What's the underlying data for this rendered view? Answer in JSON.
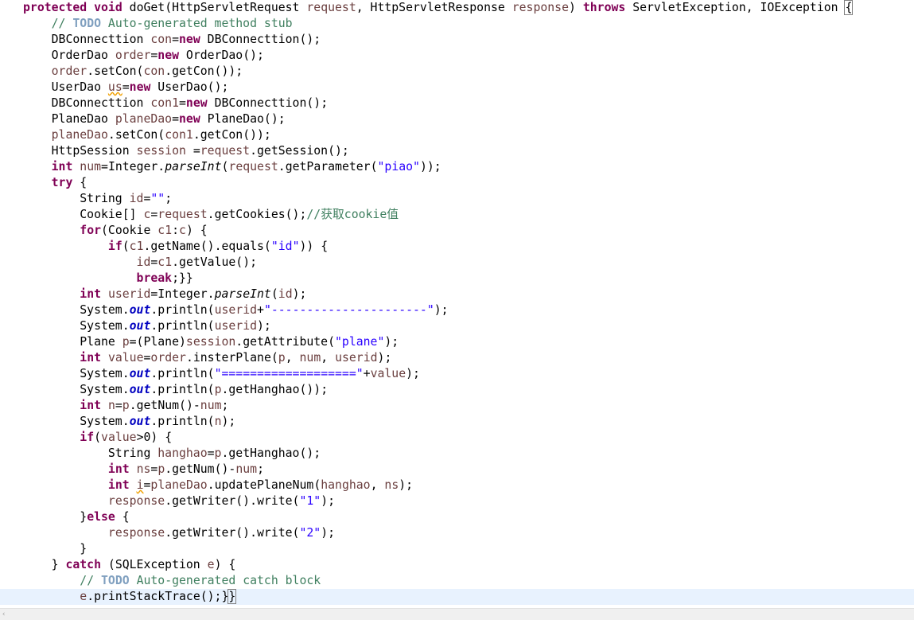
{
  "code": {
    "current_line_index": 37,
    "lines": [
      [
        [
          "kw",
          "protected"
        ],
        [
          "p",
          " "
        ],
        [
          "kw",
          "void"
        ],
        [
          "p",
          " doGet(HttpServletRequest "
        ],
        [
          "var",
          "request"
        ],
        [
          "p",
          ", HttpServletResponse "
        ],
        [
          "var",
          "response"
        ],
        [
          "p",
          ") "
        ],
        [
          "kw",
          "throws"
        ],
        [
          "p",
          " ServletException, IOException "
        ],
        [
          "bracket",
          "{"
        ]
      ],
      [
        [
          "p",
          "    "
        ],
        [
          "cm",
          "// "
        ],
        [
          "todo",
          "TODO"
        ],
        [
          "cm",
          " Auto-generated method stub"
        ]
      ],
      [
        [
          "p",
          "    DBConnecttion "
        ],
        [
          "var",
          "con"
        ],
        [
          "p",
          "="
        ],
        [
          "kw",
          "new"
        ],
        [
          "p",
          " DBConnecttion();"
        ]
      ],
      [
        [
          "p",
          "    OrderDao "
        ],
        [
          "var",
          "order"
        ],
        [
          "p",
          "="
        ],
        [
          "kw",
          "new"
        ],
        [
          "p",
          " OrderDao();"
        ]
      ],
      [
        [
          "p",
          "    "
        ],
        [
          "var",
          "order"
        ],
        [
          "p",
          ".setCon("
        ],
        [
          "var",
          "con"
        ],
        [
          "p",
          ".getCon());"
        ]
      ],
      [
        [
          "p",
          "    UserDao "
        ],
        [
          "warn",
          "us"
        ],
        [
          "p",
          "="
        ],
        [
          "kw",
          "new"
        ],
        [
          "p",
          " UserDao();"
        ]
      ],
      [
        [
          "p",
          "    DBConnecttion "
        ],
        [
          "var",
          "con1"
        ],
        [
          "p",
          "="
        ],
        [
          "kw",
          "new"
        ],
        [
          "p",
          " DBConnecttion();"
        ]
      ],
      [
        [
          "p",
          "    PlaneDao "
        ],
        [
          "var",
          "planeDao"
        ],
        [
          "p",
          "="
        ],
        [
          "kw",
          "new"
        ],
        [
          "p",
          " PlaneDao();"
        ]
      ],
      [
        [
          "p",
          "    "
        ],
        [
          "var",
          "planeDao"
        ],
        [
          "p",
          ".setCon("
        ],
        [
          "var",
          "con1"
        ],
        [
          "p",
          ".getCon());"
        ]
      ],
      [
        [
          "p",
          "    HttpSession "
        ],
        [
          "var",
          "session"
        ],
        [
          "p",
          " ="
        ],
        [
          "var",
          "request"
        ],
        [
          "p",
          ".getSession();"
        ]
      ],
      [
        [
          "p",
          "    "
        ],
        [
          "kw",
          "int"
        ],
        [
          "p",
          " "
        ],
        [
          "var",
          "num"
        ],
        [
          "p",
          "=Integer."
        ],
        [
          "it",
          "parseInt"
        ],
        [
          "p",
          "("
        ],
        [
          "var",
          "request"
        ],
        [
          "p",
          ".getParameter("
        ],
        [
          "str",
          "\"piao\""
        ],
        [
          "p",
          "));"
        ]
      ],
      [
        [
          "p",
          "    "
        ],
        [
          "kw",
          "try"
        ],
        [
          "p",
          " {"
        ]
      ],
      [
        [
          "p",
          "        String "
        ],
        [
          "var",
          "id"
        ],
        [
          "p",
          "="
        ],
        [
          "str",
          "\"\""
        ],
        [
          "p",
          ";"
        ]
      ],
      [
        [
          "p",
          "        Cookie[] "
        ],
        [
          "var",
          "c"
        ],
        [
          "p",
          "="
        ],
        [
          "var",
          "request"
        ],
        [
          "p",
          ".getCookies();"
        ],
        [
          "cm",
          "//获取cookie值"
        ]
      ],
      [
        [
          "p",
          "        "
        ],
        [
          "kw",
          "for"
        ],
        [
          "p",
          "(Cookie "
        ],
        [
          "var",
          "c1"
        ],
        [
          "p",
          ":"
        ],
        [
          "var",
          "c"
        ],
        [
          "p",
          ") {"
        ]
      ],
      [
        [
          "p",
          "            "
        ],
        [
          "kw",
          "if"
        ],
        [
          "p",
          "("
        ],
        [
          "var",
          "c1"
        ],
        [
          "p",
          ".getName().equals("
        ],
        [
          "str",
          "\"id\""
        ],
        [
          "p",
          ")) {"
        ]
      ],
      [
        [
          "p",
          "                "
        ],
        [
          "var",
          "id"
        ],
        [
          "p",
          "="
        ],
        [
          "var",
          "c1"
        ],
        [
          "p",
          ".getValue();"
        ]
      ],
      [
        [
          "p",
          "                "
        ],
        [
          "kw",
          "break"
        ],
        [
          "p",
          ";}}"
        ]
      ],
      [
        [
          "p",
          "        "
        ],
        [
          "kw",
          "int"
        ],
        [
          "p",
          " "
        ],
        [
          "var",
          "userid"
        ],
        [
          "p",
          "=Integer."
        ],
        [
          "it",
          "parseInt"
        ],
        [
          "p",
          "("
        ],
        [
          "var",
          "id"
        ],
        [
          "p",
          ");"
        ]
      ],
      [
        [
          "p",
          "        System."
        ],
        [
          "st",
          "out"
        ],
        [
          "p",
          ".println("
        ],
        [
          "var",
          "userid"
        ],
        [
          "p",
          "+"
        ],
        [
          "str",
          "\"----------------------\""
        ],
        [
          "p",
          ");"
        ]
      ],
      [
        [
          "p",
          "        System."
        ],
        [
          "st",
          "out"
        ],
        [
          "p",
          ".println("
        ],
        [
          "var",
          "userid"
        ],
        [
          "p",
          ");"
        ]
      ],
      [
        [
          "p",
          "        Plane "
        ],
        [
          "var",
          "p"
        ],
        [
          "p",
          "=(Plane)"
        ],
        [
          "var",
          "session"
        ],
        [
          "p",
          ".getAttribute("
        ],
        [
          "str",
          "\"plane\""
        ],
        [
          "p",
          ");"
        ]
      ],
      [
        [
          "p",
          "        "
        ],
        [
          "kw",
          "int"
        ],
        [
          "p",
          " "
        ],
        [
          "var",
          "value"
        ],
        [
          "p",
          "="
        ],
        [
          "var",
          "order"
        ],
        [
          "p",
          ".insterPlane("
        ],
        [
          "var",
          "p"
        ],
        [
          "p",
          ", "
        ],
        [
          "var",
          "num"
        ],
        [
          "p",
          ", "
        ],
        [
          "var",
          "userid"
        ],
        [
          "p",
          ");"
        ]
      ],
      [
        [
          "p",
          "        System."
        ],
        [
          "st",
          "out"
        ],
        [
          "p",
          ".println("
        ],
        [
          "str",
          "\"===================\""
        ],
        [
          "p",
          "+"
        ],
        [
          "var",
          "value"
        ],
        [
          "p",
          ");"
        ]
      ],
      [
        [
          "p",
          "        System."
        ],
        [
          "st",
          "out"
        ],
        [
          "p",
          ".println("
        ],
        [
          "var",
          "p"
        ],
        [
          "p",
          ".getHanghao());"
        ]
      ],
      [
        [
          "p",
          "        "
        ],
        [
          "kw",
          "int"
        ],
        [
          "p",
          " "
        ],
        [
          "var",
          "n"
        ],
        [
          "p",
          "="
        ],
        [
          "var",
          "p"
        ],
        [
          "p",
          ".getNum()-"
        ],
        [
          "var",
          "num"
        ],
        [
          "p",
          ";"
        ]
      ],
      [
        [
          "p",
          "        System."
        ],
        [
          "st",
          "out"
        ],
        [
          "p",
          ".println("
        ],
        [
          "var",
          "n"
        ],
        [
          "p",
          ");"
        ]
      ],
      [
        [
          "p",
          "        "
        ],
        [
          "kw",
          "if"
        ],
        [
          "p",
          "("
        ],
        [
          "var",
          "value"
        ],
        [
          "p",
          ">0) {"
        ]
      ],
      [
        [
          "p",
          "            String "
        ],
        [
          "var",
          "hanghao"
        ],
        [
          "p",
          "="
        ],
        [
          "var",
          "p"
        ],
        [
          "p",
          ".getHanghao();"
        ]
      ],
      [
        [
          "p",
          "            "
        ],
        [
          "kw",
          "int"
        ],
        [
          "p",
          " "
        ],
        [
          "var",
          "ns"
        ],
        [
          "p",
          "="
        ],
        [
          "var",
          "p"
        ],
        [
          "p",
          ".getNum()-"
        ],
        [
          "var",
          "num"
        ],
        [
          "p",
          ";"
        ]
      ],
      [
        [
          "p",
          "            "
        ],
        [
          "kw",
          "int"
        ],
        [
          "p",
          " "
        ],
        [
          "warn",
          "i"
        ],
        [
          "p",
          "="
        ],
        [
          "var",
          "planeDao"
        ],
        [
          "p",
          ".updatePlaneNum("
        ],
        [
          "var",
          "hanghao"
        ],
        [
          "p",
          ", "
        ],
        [
          "var",
          "ns"
        ],
        [
          "p",
          ");"
        ]
      ],
      [
        [
          "p",
          "            "
        ],
        [
          "var",
          "response"
        ],
        [
          "p",
          ".getWriter().write("
        ],
        [
          "str",
          "\"1\""
        ],
        [
          "p",
          ");"
        ]
      ],
      [
        [
          "p",
          "        }"
        ],
        [
          "kw",
          "else"
        ],
        [
          "p",
          " {"
        ]
      ],
      [
        [
          "p",
          "            "
        ],
        [
          "var",
          "response"
        ],
        [
          "p",
          ".getWriter().write("
        ],
        [
          "str",
          "\"2\""
        ],
        [
          "p",
          ");"
        ]
      ],
      [
        [
          "p",
          "        }"
        ]
      ],
      [
        [
          "p",
          "    } "
        ],
        [
          "kw",
          "catch"
        ],
        [
          "p",
          " (SQLException "
        ],
        [
          "var",
          "e"
        ],
        [
          "p",
          ") {"
        ]
      ],
      [
        [
          "p",
          "        "
        ],
        [
          "cm",
          "// "
        ],
        [
          "todo",
          "TODO"
        ],
        [
          "cm",
          " Auto-generated catch block"
        ]
      ],
      [
        [
          "p",
          "        "
        ],
        [
          "var",
          "e"
        ],
        [
          "p",
          ".printStackTrace();}"
        ],
        [
          "bracket",
          "}"
        ]
      ]
    ]
  },
  "scrollbar": {
    "left_arrow": "‹"
  },
  "colors": {
    "keyword": "#7f0055",
    "local_variable": "#6a3e3e",
    "string": "#2a00ff",
    "comment": "#3f7f5f",
    "todo": "#7f9fbf",
    "static_field": "#0000c0",
    "current_line": "#e8f2fe"
  }
}
